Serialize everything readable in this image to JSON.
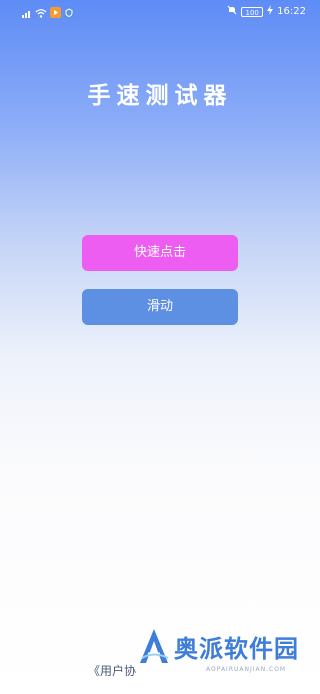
{
  "status_bar": {
    "time": "16:22",
    "battery": "100",
    "icons": [
      "signal-icon",
      "wifi-icon",
      "media-app-icon",
      "shield-app-icon",
      "mute-icon",
      "charging-icon"
    ]
  },
  "app": {
    "title": "手速测试器"
  },
  "buttons": {
    "fast_click": "快速点击",
    "slide": "滑动"
  },
  "footer": {
    "agreement_partial": "《用户协"
  },
  "watermark": {
    "text": "奥派软件园",
    "sub": "AOPAIRUANJIAN.COM"
  },
  "colors": {
    "fast_click_button": "#ee5df1",
    "slide_button": "#5d8fe3",
    "brand_blue": "#3f7ed8"
  }
}
